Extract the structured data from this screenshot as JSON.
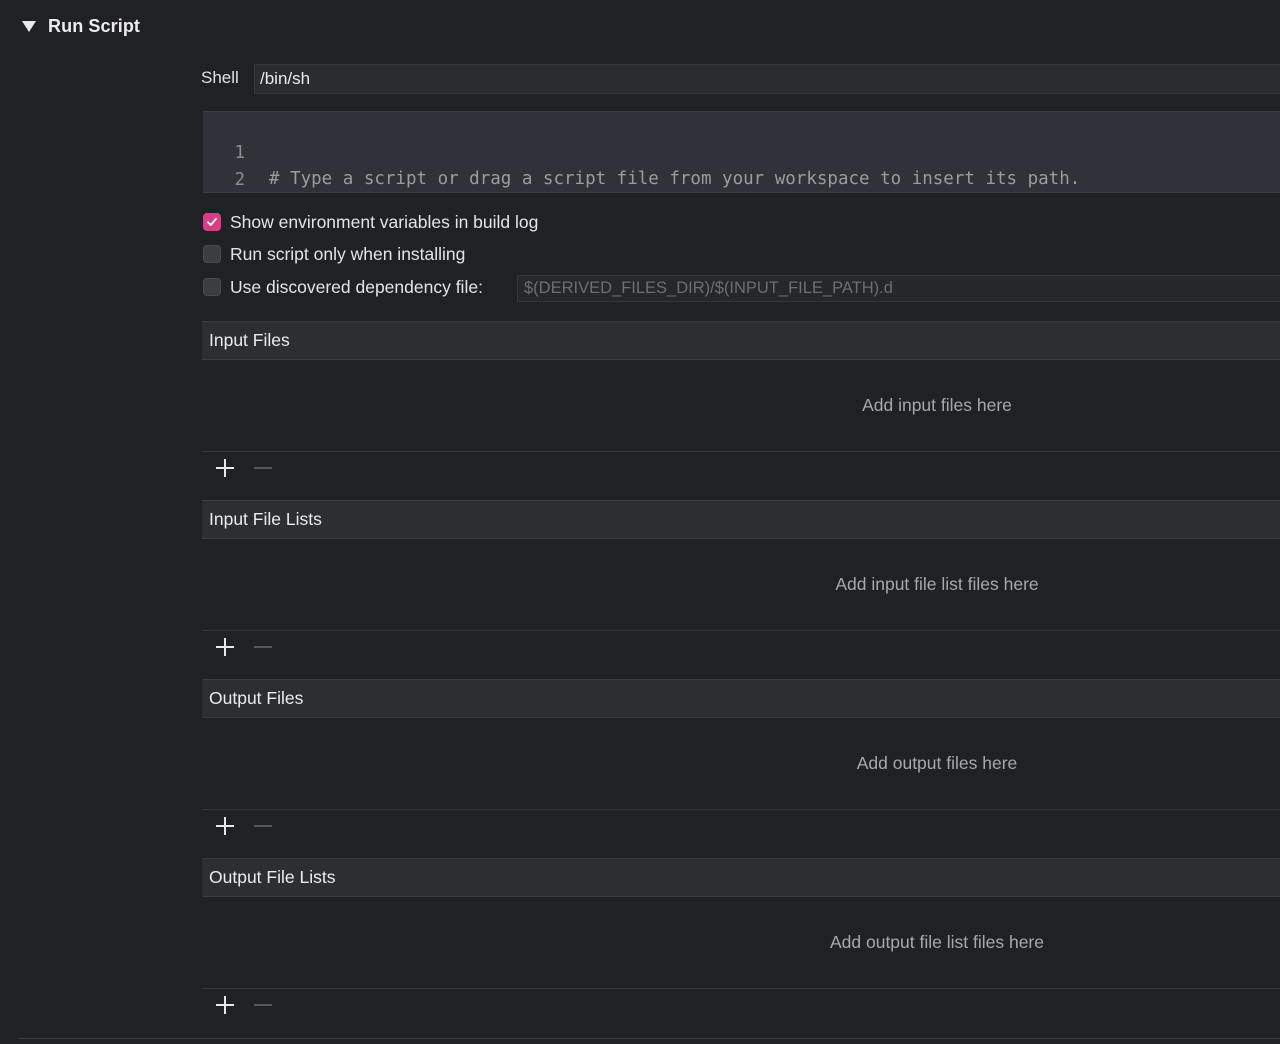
{
  "phase": {
    "title": "Run Script"
  },
  "shell": {
    "label": "Shell",
    "value": "/bin/sh"
  },
  "editor": {
    "lines": [
      {
        "number": "1",
        "code": "# Type a script or drag a script file from your workspace to insert its path."
      },
      {
        "number": "2",
        "code": ""
      }
    ]
  },
  "options": {
    "show_env_vars": {
      "label": "Show environment variables in build log",
      "checked": true
    },
    "run_only_installing": {
      "label": "Run script only when installing",
      "checked": false
    },
    "dependency_file": {
      "label": "Use discovered dependency file:",
      "checked": false,
      "placeholder": "$(DERIVED_FILES_DIR)/$(INPUT_FILE_PATH).d"
    }
  },
  "sections": {
    "input_files": {
      "title": "Input Files",
      "hint": "Add input files here"
    },
    "input_file_lists": {
      "title": "Input File Lists",
      "hint": "Add input file list files here"
    },
    "output_files": {
      "title": "Output Files",
      "hint": "Add output files here"
    },
    "output_file_lists": {
      "title": "Output File Lists",
      "hint": "Add output file list files here"
    }
  },
  "icons": {
    "disclosure": "disclosure-triangle-down-icon",
    "checkmark": "checkmark-icon",
    "add": "plus-icon",
    "remove": "minus-icon"
  },
  "colors": {
    "background": "#1f2124",
    "accent_checkbox": "#d63f87",
    "editor_background": "#2f3238",
    "section_header": "#2c2e31"
  }
}
